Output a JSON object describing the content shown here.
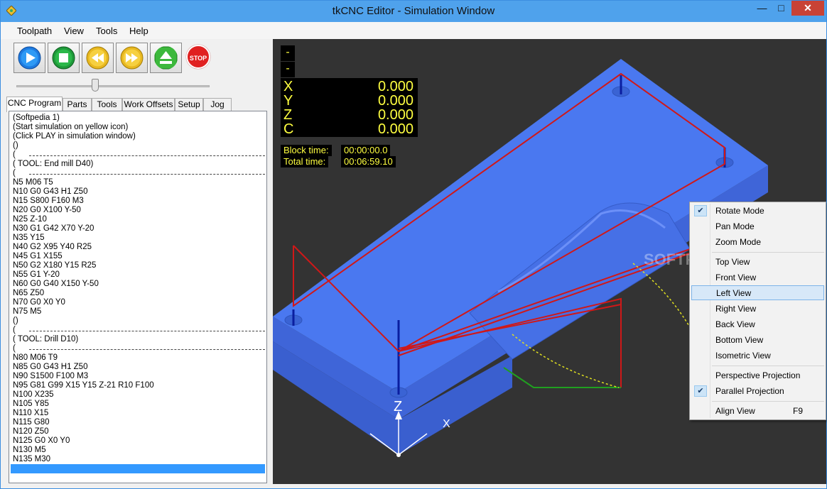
{
  "window": {
    "title": "tkCNC Editor - Simulation Window",
    "minimize": "—",
    "maximize": "□",
    "close": "✕"
  },
  "menu": [
    "Toolpath",
    "View",
    "Tools",
    "Help"
  ],
  "toolbar": {
    "play": "play-icon",
    "stop_sim": "stop-icon",
    "rewind": "rewind-icon",
    "forward": "fast-forward-icon",
    "eject": "eject-icon",
    "stop_label": "STOP"
  },
  "tabs": [
    "CNC Program",
    "Parts",
    "Tools",
    "Work Offsets",
    "Setup",
    "Jog"
  ],
  "program_lines": [
    "(Softpedia 1)",
    "(Start simulation on yellow icon)",
    "(Click PLAY in simulation window)",
    "()",
    "(",
    "( TOOL: End mill D40)",
    "(",
    "N5 M06 T5",
    "N10 G0 G43 H1 Z50",
    "N15 S800 F160 M3",
    "N20 G0 X100 Y-50",
    "N25 Z-10",
    "N30 G1 G42 X70 Y-20",
    "N35 Y15",
    "N40 G2 X95 Y40 R25",
    "N45 G1 X155",
    "N50 G2 X180 Y15 R25",
    "N55 G1 Y-20",
    "N60 G0 G40 X150 Y-50",
    "N65 Z50",
    "N70 G0 X0 Y0",
    "N75 M5",
    "()",
    "(",
    "( TOOL: Drill D10)",
    "(",
    "N80 M06 T9",
    "N85 G0 G43 H1 Z50",
    "N90 S1500 F100 M3",
    "N95 G81 G99 X15 Y15 Z-21 R10 F100",
    "N100 X235",
    "N105 Y85",
    "N110 X15",
    "N115 G80",
    "N120 Z50",
    "N125 G0 X0 Y0",
    "N130 M5",
    "N135 M30"
  ],
  "dro": {
    "top1": "-",
    "top2": "-",
    "axes": [
      {
        "axis": "X",
        "value": "0.000"
      },
      {
        "axis": "Y",
        "value": "0.000"
      },
      {
        "axis": "Z",
        "value": "0.000"
      },
      {
        "axis": "C",
        "value": "0.000"
      }
    ],
    "block_time_label": "Block time:",
    "block_time": "00:00:00.0",
    "total_time_label": "Total time:",
    "total_time": "00:06:59.10"
  },
  "scene": {
    "axis_z": "Z",
    "axis_x": "X",
    "watermark": "SOFTPEDIA",
    "part_color": "#4a78f0",
    "path_color": "#d01818",
    "background": "#333333"
  },
  "context_menu": [
    {
      "label": "Rotate Mode",
      "checked": true
    },
    {
      "label": "Pan Mode"
    },
    {
      "label": "Zoom Mode"
    },
    {
      "label": "Top View"
    },
    {
      "label": "Front View"
    },
    {
      "label": "Left View",
      "highlighted": true
    },
    {
      "label": "Right View"
    },
    {
      "label": "Back View"
    },
    {
      "label": "Bottom View"
    },
    {
      "label": "Isometric View"
    },
    {
      "label": "Perspective Projection"
    },
    {
      "label": "Parallel Projection",
      "checked": true
    },
    {
      "label": "Align View",
      "shortcut": "F9"
    }
  ]
}
